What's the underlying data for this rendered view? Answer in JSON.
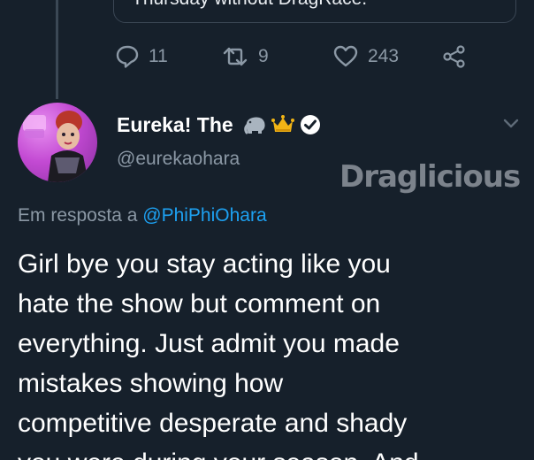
{
  "quoted_tweet": {
    "text_fragment": "Thursday without DragRace."
  },
  "actions": {
    "reply": {
      "icon": "reply-icon",
      "count": "11"
    },
    "retweet": {
      "icon": "retweet-icon",
      "count": "9"
    },
    "like": {
      "icon": "heart-icon",
      "count": "243"
    },
    "share": {
      "icon": "share-icon"
    }
  },
  "tweet": {
    "display_name": "Eureka! The",
    "name_icons": [
      "elephant-emoji-icon",
      "crown-emoji-icon",
      "verified-badge-icon"
    ],
    "handle": "@eurekaohara",
    "reply_prefix": "Em resposta a",
    "reply_mention": "@PhiPhiOhara",
    "body_lines": [
      "Girl bye you stay acting like you",
      "hate the show but comment on",
      "everything. Just admit you made",
      "mistakes showing how",
      "competitive desperate and shady",
      "you were during your season. And"
    ]
  },
  "watermark": "Draglicious",
  "colors": {
    "background": "#16202b",
    "secondary_text": "#8b98a5",
    "link": "#1da1f2",
    "primary_text": "#ffffff"
  }
}
